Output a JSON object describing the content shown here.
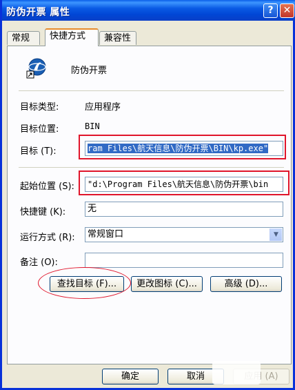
{
  "window": {
    "title": "防伪开票 属性"
  },
  "tabs": [
    {
      "label": "常规"
    },
    {
      "label": "快捷方式"
    },
    {
      "label": "兼容性"
    }
  ],
  "shortcut": {
    "name": "防伪开票",
    "target_type_label": "目标类型:",
    "target_type_value": "应用程序",
    "target_location_label": "目标位置:",
    "target_location_value": "BIN",
    "target_label": "目标 (T):",
    "target_value": "ram Files\\航天信息\\防伪开票\\BIN\\kp.exe\"",
    "start_in_label": "起始位置 (S):",
    "start_in_value": "\"d:\\Program Files\\航天信息\\防伪开票\\bin",
    "hotkey_label": "快捷键 (K):",
    "hotkey_value": "无",
    "run_label": "运行方式 (R):",
    "run_value": "常规窗口",
    "comment_label": "备注 (O):",
    "comment_value": ""
  },
  "buttons": {
    "find_target": "查找目标 (F)...",
    "change_icon": "更改图标 (C)...",
    "advanced": "高级 (D)...",
    "ok": "确定",
    "cancel": "取消",
    "apply": "应用 (A)"
  },
  "colors": {
    "titlebar": "#0a5ae4",
    "annotation": "#e0142a",
    "selection": "#316ac5"
  }
}
